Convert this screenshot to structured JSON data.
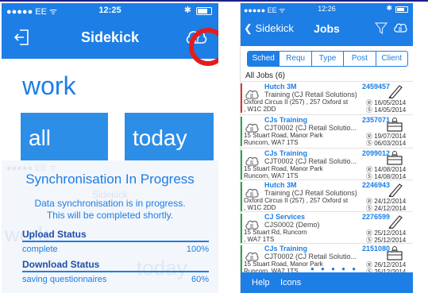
{
  "left": {
    "status": {
      "carrier": "●●●●● EE ᯤ",
      "time": "12:25",
      "bt": "✱"
    },
    "nav": {
      "title": "Sidekick"
    },
    "heading": "work",
    "tiles": {
      "all": "all",
      "today": "today"
    },
    "sync": {
      "status_ghost": "●●●●● EE ᯤ",
      "title": "Synchronisation In Progress",
      "ghost_title": "Sidekick",
      "message_line1": "Data synchronisation is in progress.",
      "message_line2": "This will be completed shortly.",
      "upload_label": "Upload Status",
      "upload_status": "complete",
      "upload_percent": "100%",
      "download_label": "Download Status",
      "download_status": "saving questionnaires",
      "download_percent": "60%",
      "ghost_work": "work",
      "ghost_today": "today"
    }
  },
  "right": {
    "status": {
      "carrier": "●●●●● EE ᯤ",
      "time": "12:26",
      "bt": "✱"
    },
    "nav": {
      "back": "❮ Sidekick",
      "title": "Jobs"
    },
    "tabs": [
      "Sched",
      "Requ",
      "Type",
      "Post",
      "Client"
    ],
    "active_tab": "Sched",
    "section_title": "All Jobs (6)",
    "jobs": [
      {
        "name": "Hutch 3M",
        "code": "Training (CJ Retail Solutions)",
        "addr1": "Oxford Circus II (257) , 257 Oxford st",
        "addr2": ", W1C 2DD",
        "number": "2459457",
        "d1": "Ⓡ 16/05/2014",
        "d2": "Ⓢ 14/05/2014",
        "icon": "pen-icon",
        "stripe": "#e0362c"
      },
      {
        "name": "CJs Training",
        "code": "CJT0002 (CJ Retail Solutio...",
        "addr1": "15 Stuart Road, Manor Park",
        "addr2": "Runcorn, WA7 1TS",
        "number": "2357071",
        "d1": "Ⓡ 19/07/2014",
        "d2": "Ⓢ 06/03/2014",
        "icon": "briefcase-icon",
        "stripe": "#2aa84a"
      },
      {
        "name": "CJs Training",
        "code": "CJT0002 (CJ Retail Solutio...",
        "addr1": "15 Stuart Road, Manor Park",
        "addr2": "Runcorn, WA7 1TS",
        "number": "2099012",
        "d1": "Ⓡ 14/08/2014",
        "d2": "Ⓢ 14/08/2014",
        "icon": "briefcase-icon",
        "stripe": "#2aa84a"
      },
      {
        "name": "Hutch 3M",
        "code": "Training (CJ Retail Solutions)",
        "addr1": "Oxford Circus II (257) , 257 Oxford st",
        "addr2": ", W1C 2DD",
        "number": "2246943",
        "d1": "Ⓡ 24/12/2014",
        "d2": "Ⓢ 24/12/2014",
        "icon": "pen-icon",
        "stripe": "#2aa84a"
      },
      {
        "name": "CJ Services",
        "code": "CJS0002 (Demo)",
        "addr1": "15 Stuart Rd, Runcorn",
        "addr2": ", WA7 1TS",
        "number": "2276599",
        "d1": "Ⓡ 25/12/2014",
        "d2": "Ⓢ 25/12/2014",
        "icon": "pen-icon",
        "stripe": "#2aa84a"
      },
      {
        "name": "CJs Training",
        "code": "CJT0002 (CJ Retail Solutio...",
        "addr1": "15 Stuart Road, Manor Park",
        "addr2": "Runcorn, WA7 1TS",
        "number": "2151080",
        "d1": "Ⓡ 26/12/2014",
        "d2": "Ⓢ 25/12/2014",
        "icon": "briefcase-icon",
        "stripe": "#2aa84a"
      }
    ],
    "page_dots": "● ● ● ● ●",
    "tabbar": {
      "help": "Help",
      "icons": "Icons"
    }
  },
  "colors": {
    "accent": "#1d7ee6",
    "highlight_ring": "#e31d1d"
  }
}
